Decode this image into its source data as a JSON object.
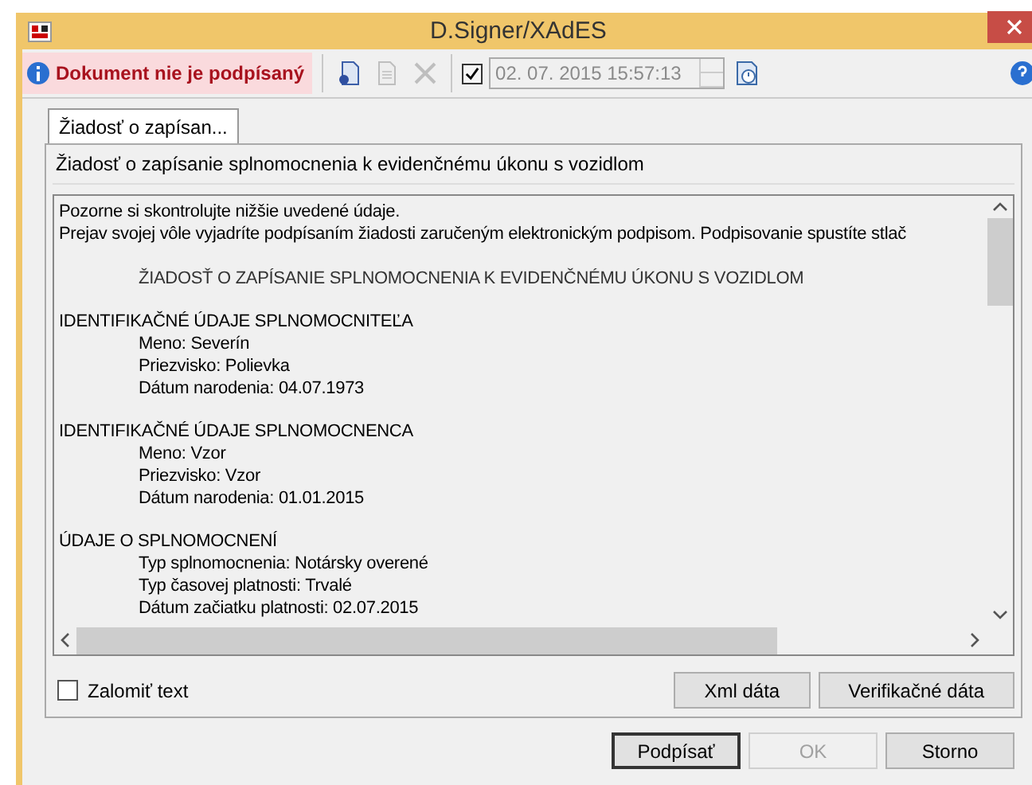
{
  "window": {
    "title": "D.Signer/XAdES"
  },
  "toolbar": {
    "status": "Dokument nie je podpísaný",
    "signed": false,
    "timestamp_enabled": true,
    "datetime": "02. 07. 2015 15:57:13",
    "datetime_disabled": true
  },
  "tabs": [
    {
      "label": "Žiadosť o zapísan...",
      "selected": true
    }
  ],
  "panel": {
    "heading": "Žiadosť o zapísanie splnomocnenia k evidenčnému úkonu s vozidlom"
  },
  "document": {
    "lines": [
      {
        "kind": "plain",
        "text": "Pozorne si skontrolujte nižšie uvedené údaje."
      },
      {
        "kind": "plain",
        "text": "Prejav svojej vôle vyjadríte podpísaním žiadosti zaručeným elektronickým podpisom. Podpisovanie spustíte stlač"
      },
      {
        "kind": "title",
        "text": "ŽIADOSŤ O ZAPÍSANIE SPLNOMOCNENIA K EVIDENČNÉMU ÚKONU S VOZIDLOM"
      },
      {
        "kind": "section",
        "text": "IDENTIFIKAČNÉ ÚDAJE SPLNOMOCNITEĽA"
      },
      {
        "kind": "field",
        "text": "Meno: Severín"
      },
      {
        "kind": "field",
        "text": "Priezvisko: Polievka"
      },
      {
        "kind": "field",
        "text": "Dátum narodenia: 04.07.1973"
      },
      {
        "kind": "section",
        "text": "IDENTIFIKAČNÉ ÚDAJE SPLNOMOCNENCA"
      },
      {
        "kind": "field",
        "text": "Meno: Vzor"
      },
      {
        "kind": "field",
        "text": "Priezvisko: Vzor"
      },
      {
        "kind": "field",
        "text": "Dátum narodenia: 01.01.2015"
      },
      {
        "kind": "section",
        "text": "ÚDAJE O SPLNOMOCNENÍ"
      },
      {
        "kind": "field",
        "text": "Typ splnomocnenia: Notársky overené"
      },
      {
        "kind": "field",
        "text": "Typ časovej platnosti: Trvalé"
      },
      {
        "kind": "field",
        "text": "Dátum začiatku platnosti: 02.07.2015"
      }
    ]
  },
  "wrap_text": {
    "label": "Zalomiť text",
    "checked": false
  },
  "panel_buttons": [
    {
      "label": "Xml dáta",
      "disabled": false
    },
    {
      "label": "Verifikačné dáta",
      "disabled": false
    }
  ],
  "dialog_buttons": [
    {
      "label": "Podpísať",
      "disabled": false,
      "default": true
    },
    {
      "label": "OK",
      "disabled": true,
      "default": false
    },
    {
      "label": "Storno",
      "disabled": false,
      "default": false
    }
  ]
}
